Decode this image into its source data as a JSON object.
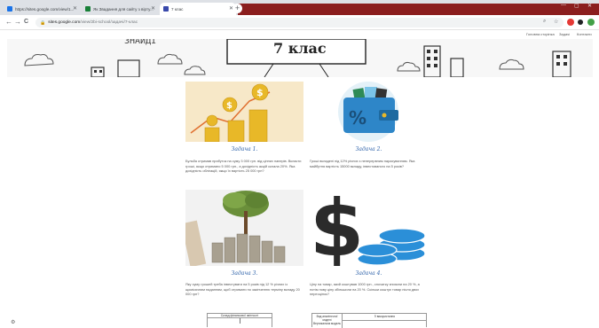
{
  "browser": {
    "tabs": [
      {
        "label": "https://sites.google.com/view/1...",
        "favicon_color": "#1a73e8"
      },
      {
        "label": "Як Звадання для сайту з вiрту...",
        "favicon_color": "#188038"
      },
      {
        "label": "7 клас",
        "favicon_color": "#3949ab"
      }
    ],
    "new_tab": "+",
    "address": {
      "host": "sites.google.com",
      "path": "/view/2bi-school/задачi/7-клас"
    },
    "nav": {
      "back": "←",
      "forward": "→",
      "reload": "C",
      "home": "⌂"
    }
  },
  "site": {
    "nav_items": [
      "Головна сторінка",
      "Задачі",
      "Контакти"
    ],
    "banner_title": "7 клас",
    "banner_word": "ЗНАЙДІ"
  },
  "tasks": [
    {
      "title": "Задача 1.",
      "text": "Бульба отримав прибуток на суму 3 000 грн. від цінних паперів. Вкласти гроші, якщо отримано 5 000 грн., а дохідність акцій склала 20%. Яка дохідність облігацій, якщо їх вартість 25 000 грн?"
    },
    {
      "title": "Задача 2.",
      "text": "Гроші вкладені під 12% річних з неперервним нарахуванням. Яка майбутня вартість 15000 вкладу, інвестованого на 5 років?"
    },
    {
      "title": "Задача 3.",
      "text": "Яку суму грошей треба інвестувати на 5 років під 12 % річних із щомісячним наданням, щоб отримати по закінченню терміну вкладу 20 000 грн?"
    },
    {
      "title": "Задача 4.",
      "text": "Ціну на товар, який коштував 1000 грн., спочатку знизили на 20 %, а потім нову ціну збільшили на 20 %. Скільки коштує товар після двох переоцінок?"
    }
  ],
  "tables": {
    "left_caption": "Склад фінансової звітності",
    "right_col1": "Вид аналітичної моделі",
    "right_col2": "Її використання",
    "right_row1": "Вертикальна модель"
  },
  "colors": {
    "accent_blue": "#2a5fa8",
    "coin_gold": "#e8b828",
    "wallet_blue": "#2e86c8",
    "dollar_dark": "#2b2b2b",
    "coin_blue": "#2b8fd8"
  }
}
